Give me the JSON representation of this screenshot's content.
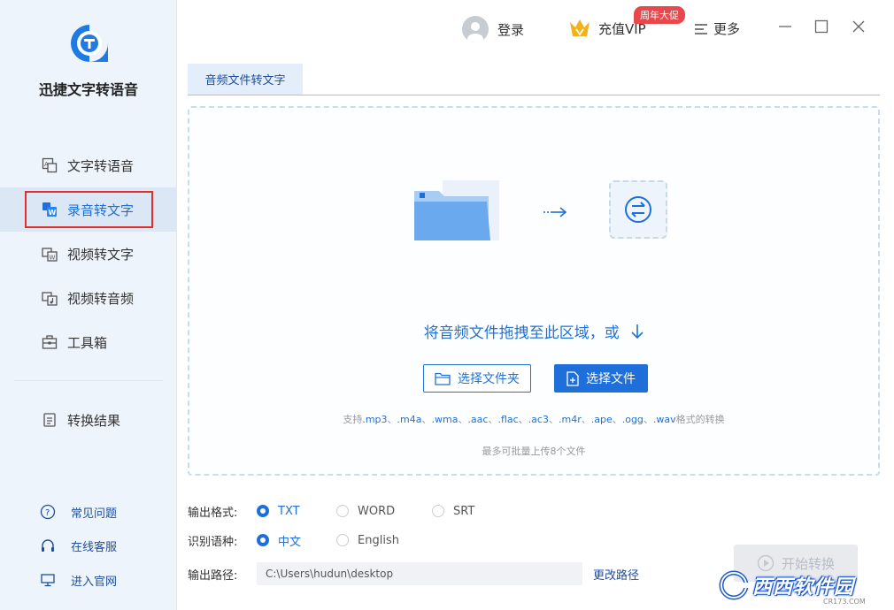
{
  "app": {
    "name": "迅捷文字转语音"
  },
  "sidebar": {
    "items": [
      {
        "label": "文字转语音",
        "icon": "text-to-speech-icon"
      },
      {
        "label": "录音转文字",
        "icon": "audio-to-word-icon",
        "active": true
      },
      {
        "label": "视频转文字",
        "icon": "video-to-word-icon"
      },
      {
        "label": "视频转音频",
        "icon": "video-to-audio-icon"
      },
      {
        "label": "工具箱",
        "icon": "toolbox-icon"
      }
    ],
    "result_label": "转换结果",
    "links": [
      {
        "label": "常见问题",
        "icon": "question-icon"
      },
      {
        "label": "在线客服",
        "icon": "headset-icon"
      },
      {
        "label": "进入官网",
        "icon": "monitor-icon"
      }
    ]
  },
  "topbar": {
    "login_label": "登录",
    "vip_label": "充值VIP",
    "vip_badge": "周年大促",
    "more_label": "更多"
  },
  "tabs": [
    {
      "label": "音频文件转文字",
      "active": true
    }
  ],
  "dropzone": {
    "title": "将音频文件拖拽至此区域，或",
    "select_folder_label": "选择文件夹",
    "select_file_label": "选择文件",
    "formats_prefix": "支持",
    "formats": [
      ".mp3",
      ".m4a",
      ".wma",
      ".aac",
      ".flac",
      ".ac3",
      ".m4r",
      ".ape",
      ".ogg",
      ".wav"
    ],
    "formats_sep": "、",
    "formats_suffix": "格式的转换",
    "limit_text": "最多可批量上传8个文件"
  },
  "options": {
    "format_label": "输出格式:",
    "format_choices": [
      "TXT",
      "WORD",
      "SRT"
    ],
    "format_selected": "TXT",
    "lang_label": "识别语种:",
    "lang_choices": [
      "中文",
      "English"
    ],
    "lang_selected": "中文",
    "path_label": "输出路径:",
    "path_value": "C:\\Users\\hudun\\desktop",
    "change_path_label": "更改路径"
  },
  "start_label": "开始转换",
  "watermark": {
    "text": "西西软件园",
    "sub": "CR173.COM"
  },
  "colors": {
    "accent": "#1e6fd9",
    "sidebar_bg": "#eef4fb",
    "highlight_border": "#e0302d",
    "vip_badge": "#e8484b"
  }
}
